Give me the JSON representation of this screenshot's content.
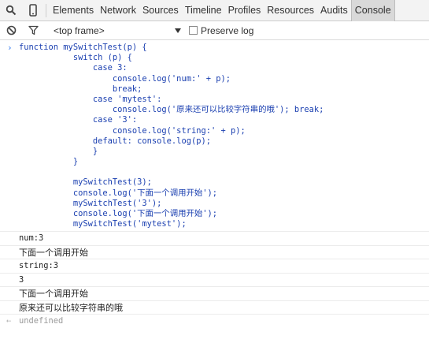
{
  "tabs": [
    {
      "label": "Elements"
    },
    {
      "label": "Network"
    },
    {
      "label": "Sources"
    },
    {
      "label": "Timeline"
    },
    {
      "label": "Profiles"
    },
    {
      "label": "Resources"
    },
    {
      "label": "Audits"
    },
    {
      "label": "Console",
      "selected": true
    }
  ],
  "toolbar": {
    "frame": "<top frame>",
    "preserve_log_label": "Preserve log",
    "preserve_log_checked": false
  },
  "console": {
    "prompt": "›",
    "input_code": [
      "function mySwitchTest(p) {",
      "           switch (p) {",
      "               case 3:",
      "                   console.log('num:' + p);",
      "                   break;",
      "               case 'mytest':",
      "                   console.log('原来还可以比较字符串的哦'); break;",
      "               case '3':",
      "                   console.log('string:' + p);",
      "               default: console.log(p);",
      "               }",
      "           }",
      "",
      "           mySwitchTest(3);",
      "           console.log('下面一个调用开始');",
      "           mySwitchTest('3');",
      "           console.log('下面一个调用开始');",
      "           mySwitchTest('mytest');"
    ],
    "output": [
      "num:3",
      "下面一个调用开始",
      "string:3",
      "3",
      "下面一个调用开始",
      "原来还可以比较字符串的哦"
    ],
    "result_prefix": "←",
    "result": "undefined"
  },
  "colors": {
    "code": "#1a3fb0",
    "prompt": "#367cf1",
    "result": "#999999"
  },
  "icons": [
    "search-icon",
    "device-icon",
    "clear-console-icon",
    "filter-icon",
    "dropdown-arrow-icon"
  ]
}
